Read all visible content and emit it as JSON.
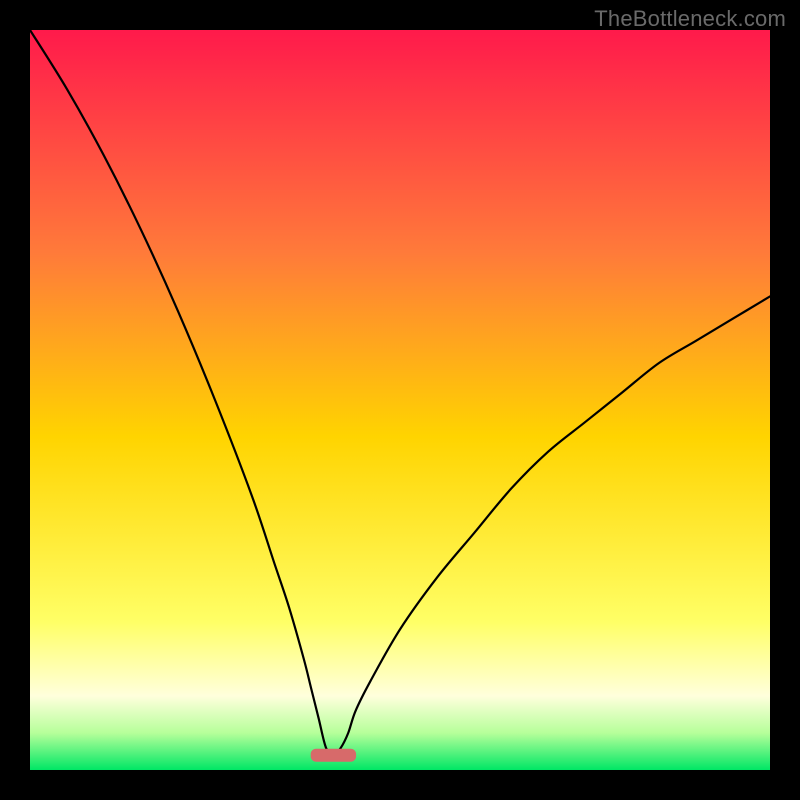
{
  "watermark": "TheBottleneck.com",
  "colors": {
    "gradient_top": "#ff1a4b",
    "gradient_mid_upper": "#ff7a3a",
    "gradient_mid": "#ffd400",
    "gradient_lower": "#ffff66",
    "gradient_pale": "#ffffdc",
    "gradient_green_light": "#b6ff9a",
    "gradient_green": "#00e765",
    "curve": "#000000",
    "marker": "#d76a6a",
    "frame": "#000000"
  },
  "chart_data": {
    "type": "line",
    "title": "",
    "xlabel": "",
    "ylabel": "",
    "xlim": [
      0,
      100
    ],
    "ylim": [
      0,
      100
    ],
    "x_at_minimum": 41,
    "marker": {
      "x_center": 41,
      "width": 6,
      "y": 2
    },
    "series": [
      {
        "name": "bottleneck-curve",
        "x": [
          0,
          5,
          10,
          15,
          20,
          25,
          30,
          33,
          35,
          37,
          38,
          39,
          40,
          41,
          42,
          43,
          44,
          46,
          50,
          55,
          60,
          65,
          70,
          75,
          80,
          85,
          90,
          95,
          100
        ],
        "values": [
          100,
          92,
          83,
          73,
          62,
          50,
          37,
          28,
          22,
          15,
          11,
          7,
          3,
          2,
          3,
          5,
          8,
          12,
          19,
          26,
          32,
          38,
          43,
          47,
          51,
          55,
          58,
          61,
          64
        ]
      }
    ],
    "annotations": []
  }
}
